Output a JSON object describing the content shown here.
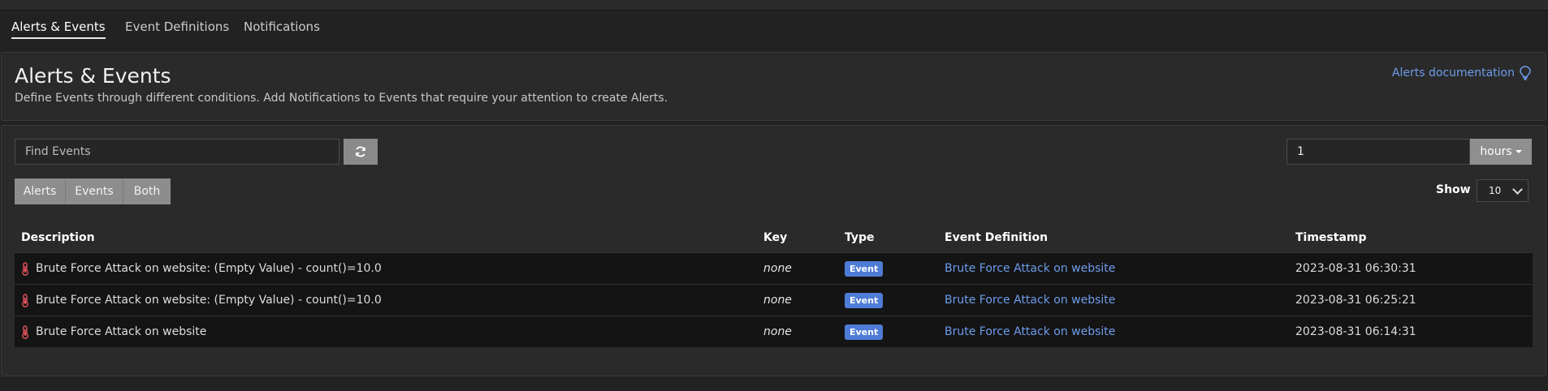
{
  "tabs": [
    "Alerts & Events",
    "Event Definitions",
    "Notifications"
  ],
  "header": {
    "title": "Alerts & Events",
    "subtitle": "Define Events through different conditions. Add Notifications to Events that require your attention to create Alerts.",
    "doc_link": "Alerts documentation",
    "doc_icon": "lightbulb-icon"
  },
  "search": {
    "placeholder": "Find Events",
    "value": ""
  },
  "refresh_icon": "refresh-icon",
  "time_range": {
    "value": "1",
    "unit_label": "hours"
  },
  "filters": [
    "Alerts",
    "Events",
    "Both"
  ],
  "show": {
    "label": "Show",
    "value": "10"
  },
  "table": {
    "columns": [
      "Description",
      "Key",
      "Type",
      "Event Definition",
      "Timestamp"
    ],
    "rows": [
      {
        "description": "Brute Force Attack on website: (Empty Value) - count()=10.0",
        "key": "none",
        "type": "Event",
        "definition": "Brute Force Attack on website",
        "timestamp": "2023-08-31 06:30:31"
      },
      {
        "description": "Brute Force Attack on website: (Empty Value) - count()=10.0",
        "key": "none",
        "type": "Event",
        "definition": "Brute Force Attack on website",
        "timestamp": "2023-08-31 06:25:21"
      },
      {
        "description": "Brute Force Attack on website",
        "key": "none",
        "type": "Event",
        "definition": "Brute Force Attack on website",
        "timestamp": "2023-08-31 06:14:31"
      }
    ]
  },
  "colors": {
    "accent": "#6d9ceb",
    "badge": "#4f7cd6",
    "alert_icon": "#e5535b"
  }
}
